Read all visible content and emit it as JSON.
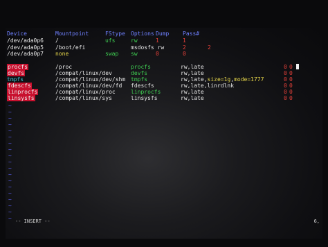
{
  "fstab": {
    "header": {
      "device": "Device",
      "mountpoint": "Mountpoint",
      "fstype": "FStype",
      "options": "Options",
      "dump": "Dump",
      "pass": "Pass#"
    },
    "rows": [
      {
        "device": "/dev/ada0p6",
        "mountpoint": "/",
        "fstype": "ufs",
        "options": "rw",
        "dump": "1",
        "pass": "1"
      },
      {
        "device": "/dev/ada0p5",
        "mountpoint": "/boot/efi",
        "fstype": "",
        "options": "msdosfs rw",
        "dump": "2",
        "pass": "2"
      },
      {
        "device": "/dev/ada0p7",
        "mountpoint": "none",
        "fstype": "swap",
        "options": "sw",
        "dump": "0",
        "pass": "0"
      }
    ],
    "rows2": [
      {
        "device": "procfs",
        "mountpoint": "/proc",
        "fstype": "procfs",
        "options": "rw,late",
        "dump": "0",
        "pass": "0"
      },
      {
        "device": "devfs",
        "mountpoint": "/compat/linux/dev",
        "fstype": "devfs",
        "options": "rw,late",
        "dump": "0",
        "pass": "0"
      },
      {
        "device": "tmpfs",
        "mountpoint": "/compat/linux/dev/shm",
        "fstype": "tmpfs",
        "options_a": "rw,late,",
        "options_b": "size=1g",
        "options_c": ",",
        "options_d": "mode=1777",
        "dump": "0",
        "pass": "0"
      },
      {
        "device": "fdescfs",
        "mountpoint": "/compat/linux/dev/fd",
        "fstype": "fdescfs",
        "options": "rw,late,linrdlnk",
        "dump": "0",
        "pass": "0"
      },
      {
        "device": "linprocfs",
        "mountpoint": "/compat/linux/proc",
        "fstype": "linprocfs",
        "options": "rw,late",
        "dump": "0",
        "pass": "0"
      },
      {
        "device": "linsysfs",
        "mountpoint": "/compat/linux/sys",
        "fstype": "linsysfs",
        "options": "rw,late",
        "dump": "0",
        "pass": "0"
      }
    ]
  },
  "tilde": "~",
  "status": {
    "mode": "-- INSERT --",
    "position": "6,"
  }
}
